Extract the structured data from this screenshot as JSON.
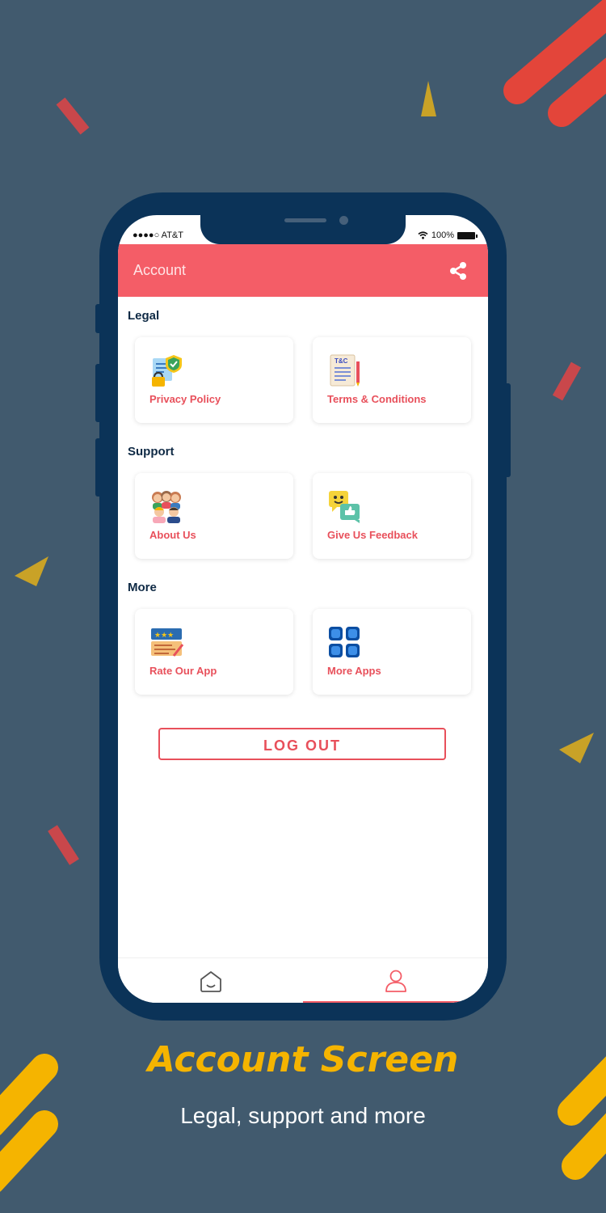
{
  "caption": {
    "title": "Account Screen",
    "subtitle": "Legal, support and more"
  },
  "status_bar": {
    "carrier": "●●●●○ AT&T",
    "battery": "100%"
  },
  "appbar": {
    "title": "Account",
    "share_icon": "share-icon"
  },
  "sections": [
    {
      "title": "Legal",
      "items": [
        {
          "label": "Privacy Policy",
          "icon": "privacy-icon"
        },
        {
          "label": "Terms & Conditions",
          "icon": "terms-icon",
          "icon_text": "T&C"
        }
      ]
    },
    {
      "title": "Support",
      "items": [
        {
          "label": "About Us",
          "icon": "team-icon"
        },
        {
          "label": "Give Us Feedback",
          "icon": "feedback-icon"
        }
      ]
    },
    {
      "title": "More",
      "items": [
        {
          "label": "Rate Our App",
          "icon": "rating-icon"
        },
        {
          "label": "More Apps",
          "icon": "apps-grid-icon"
        }
      ]
    }
  ],
  "logout_label": "LOG OUT",
  "bottom_nav": {
    "items": [
      {
        "icon": "home-icon",
        "active": false
      },
      {
        "icon": "profile-icon",
        "active": true
      }
    ]
  },
  "colors": {
    "background": "#415a6e",
    "phone": "#0b3358",
    "accent": "#f45d67",
    "caption": "#f5b400"
  }
}
